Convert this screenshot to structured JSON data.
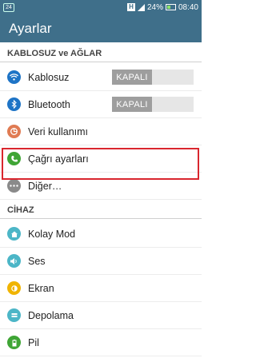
{
  "status_bar": {
    "notification_badge": "24",
    "network_letter": "H",
    "battery": "24%",
    "time": "08:40"
  },
  "app_bar": {
    "title": "Ayarlar"
  },
  "sections": {
    "wireless": {
      "header": "KABLOSUZ ve AĞLAR",
      "items": {
        "wifi": {
          "label": "Kablosuz",
          "toggle": "KAPALI",
          "icon": "wifi-icon",
          "color": "#1e74c6"
        },
        "bluetooth": {
          "label": "Bluetooth",
          "toggle": "KAPALI",
          "icon": "bluetooth-icon",
          "color": "#1e74c6"
        },
        "data": {
          "label": "Veri kullanımı",
          "icon": "data-usage-icon",
          "color": "#e07b53"
        },
        "call": {
          "label": "Çağrı ayarları",
          "icon": "phone-icon",
          "color": "#3fa535"
        },
        "more": {
          "label": "Diğer…",
          "icon": "more-icon",
          "color": "#8a8a8a"
        }
      }
    },
    "device": {
      "header": "CİHAZ",
      "items": {
        "easy": {
          "label": "Kolay Mod",
          "icon": "easy-mode-icon",
          "color": "#4cb6c7"
        },
        "sound": {
          "label": "Ses",
          "icon": "sound-icon",
          "color": "#4cb6c7"
        },
        "display": {
          "label": "Ekran",
          "icon": "display-icon",
          "color": "#f0b400"
        },
        "storage": {
          "label": "Depolama",
          "icon": "storage-icon",
          "color": "#4cb6c7"
        },
        "battery": {
          "label": "Pil",
          "icon": "battery-icon",
          "color": "#3fa535"
        }
      }
    }
  },
  "highlight_color": "#d9262e"
}
